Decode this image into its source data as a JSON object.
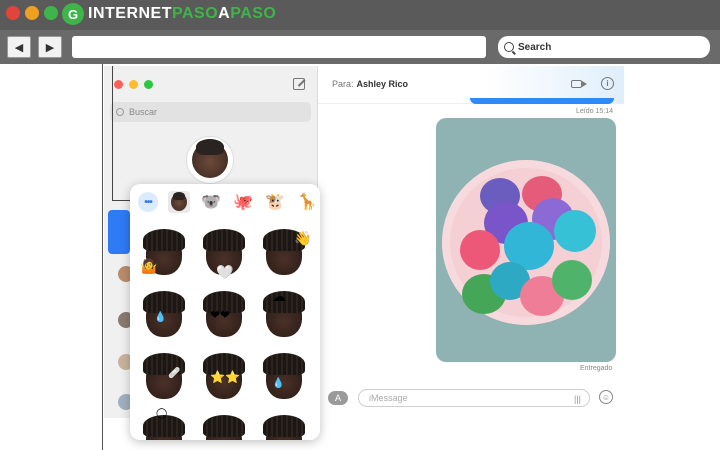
{
  "browser": {
    "logo_mark": "G",
    "logo_part1": "INTERNET",
    "logo_part2": "PASO",
    "logo_part3": "A",
    "logo_part4": "PASO",
    "back_icon": "back-arrow-icon",
    "forward_icon": "forward-arrow-icon",
    "url_value": "",
    "search_label": "Search",
    "colors": {
      "chrome_dark": "#5a5a5a",
      "chrome_bar": "#6a6a6a",
      "brand_green": "#3eb44a"
    }
  },
  "messages": {
    "sidebar": {
      "search_placeholder": "Buscar",
      "window_controls": [
        "close",
        "minimize",
        "zoom"
      ]
    },
    "conversation": {
      "to_label": "Para:",
      "recipient": "Ashley Rico",
      "read_status": "Leído 15:14",
      "delivered_status": "Entregado",
      "input_placeholder": "iMessage",
      "accent_color": "#2f8af5"
    },
    "memoji_popover": {
      "more_label": "•••",
      "top_row_icons": [
        "memoji-icon",
        "koala-icon",
        "octopus-icon",
        "cow-icon",
        "giraffe-icon"
      ],
      "top_row_glyphs": [
        "🐨",
        "🐙",
        "🐮",
        "🦒"
      ],
      "stickers": [
        "memoji-shrug-sticker",
        "memoji-heart-hands-sticker",
        "memoji-wave-sticker",
        "memoji-crying-laughing-sticker",
        "memoji-heart-eyes-sticker",
        "memoji-mind-blown-sticker",
        "memoji-bandage-sticker",
        "memoji-star-eyes-sticker",
        "memoji-tear-sticker",
        "memoji-halo-sticker",
        "memoji-sleeping-sticker",
        "memoji-tongue-sticker"
      ]
    }
  }
}
